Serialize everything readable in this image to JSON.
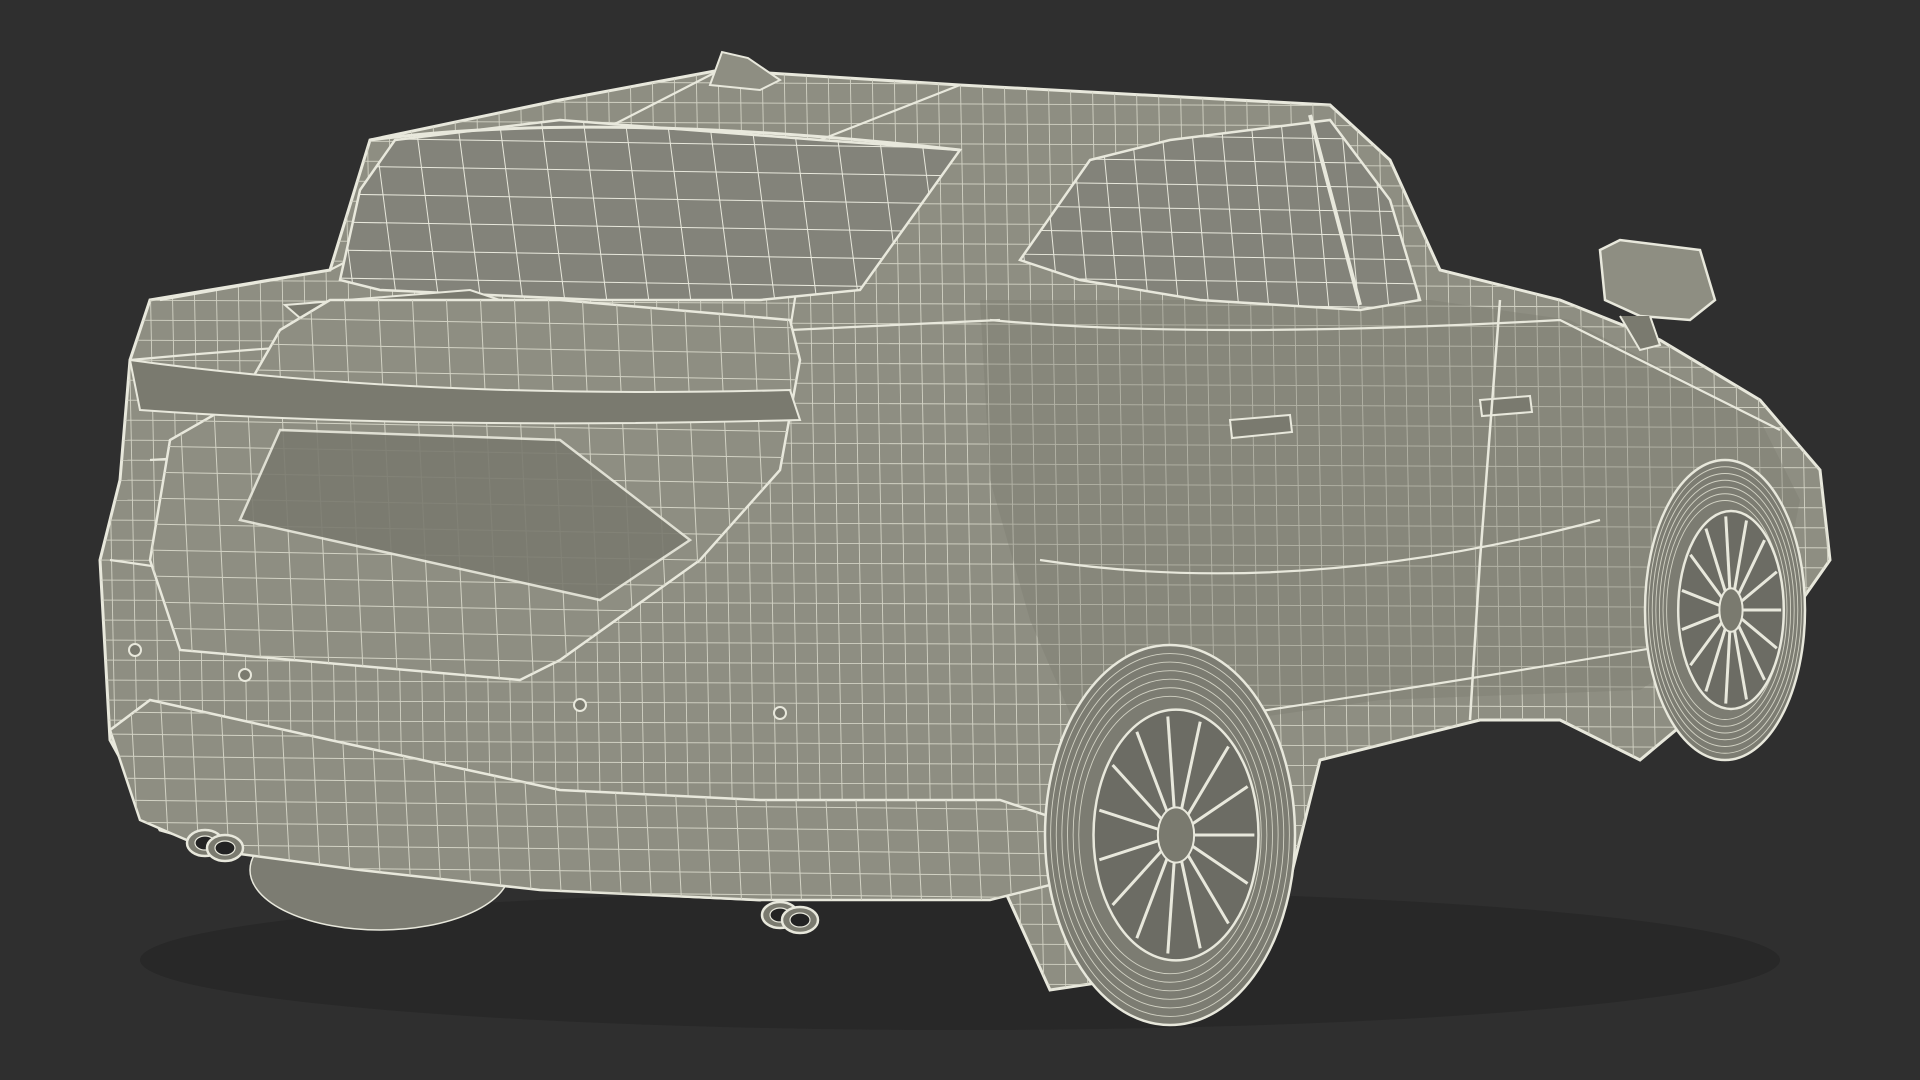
{
  "scene": {
    "subject": "wireframe-suv-rear-three-quarter",
    "colors": {
      "background": "#2f2f2f",
      "body_fill": "#8e8e82",
      "body_shade": "#7a7a6f",
      "glass_fill": "#83837a",
      "wire": "#e8e8dc",
      "wire_fine": "#d2d2c4",
      "tire_fill": "#7c7c72",
      "rim_fill": "#6c6c64",
      "shadow": "#232323"
    }
  }
}
